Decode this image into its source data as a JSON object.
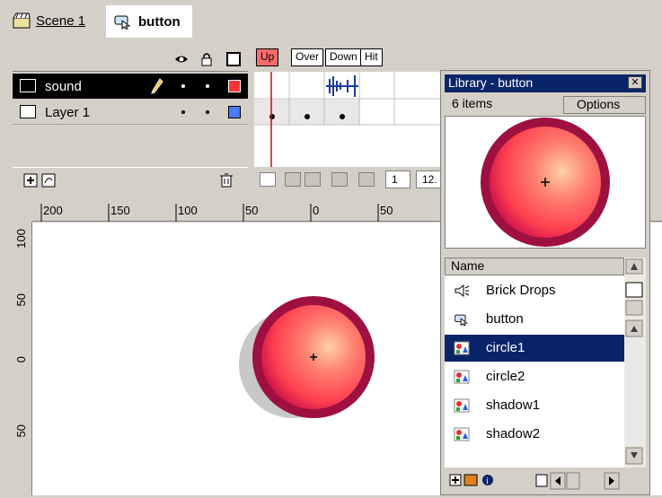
{
  "breadcrumb": {
    "scene_label": "Scene 1",
    "symbol_label": "button"
  },
  "timeline": {
    "layers": [
      {
        "name": "sound",
        "selected": true,
        "outline_color": "#ff3333"
      },
      {
        "name": "Layer 1",
        "selected": false,
        "outline_color": "#4a7cff"
      }
    ],
    "frame_labels": [
      "Up",
      "Over",
      "Down",
      "Hit"
    ],
    "current_frame": "1",
    "frame_rate": "12."
  },
  "rulers": {
    "horizontal": [
      "200",
      "150",
      "100",
      "50",
      "0",
      "50"
    ],
    "vertical": [
      "100",
      "50",
      "0",
      "50"
    ]
  },
  "library": {
    "title": "Library - button",
    "item_count": "6 items",
    "options_label": "Options",
    "name_header": "Name",
    "items": [
      {
        "label": "Brick Drops",
        "icon": "sound-icon"
      },
      {
        "label": "button",
        "icon": "button-symbol-icon"
      },
      {
        "label": "circle1",
        "icon": "graphic-symbol-icon",
        "selected": true
      },
      {
        "label": "circle2",
        "icon": "graphic-symbol-icon"
      },
      {
        "label": "shadow1",
        "icon": "graphic-symbol-icon"
      },
      {
        "label": "shadow2",
        "icon": "graphic-symbol-icon"
      }
    ]
  },
  "colors": {
    "selection": "#0a246a",
    "circle_outer": "#c8104a",
    "circle_inner": "#ff5a5a",
    "circle_highlight": "#ffc8a0"
  }
}
